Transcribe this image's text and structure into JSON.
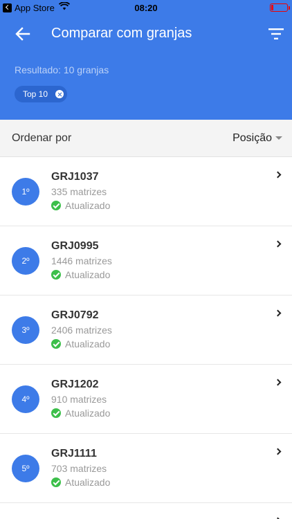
{
  "status_bar": {
    "carrier": "App Store",
    "time": "08:20"
  },
  "header": {
    "title": "Comparar com granjas",
    "result_text": "Resultado: 10 granjas",
    "chip_label": "Top 10",
    "accent_color": "#3d7be8"
  },
  "sort": {
    "label": "Ordenar por",
    "value": "Posição"
  },
  "farms": [
    {
      "rank": "1º",
      "code": "GRJ1037",
      "matrices": "335 matrizes",
      "status": "Atualizado"
    },
    {
      "rank": "2º",
      "code": "GRJ0995",
      "matrices": "1446 matrizes",
      "status": "Atualizado"
    },
    {
      "rank": "3º",
      "code": "GRJ0792",
      "matrices": "2406 matrizes",
      "status": "Atualizado"
    },
    {
      "rank": "4º",
      "code": "GRJ1202",
      "matrices": "910 matrizes",
      "status": "Atualizado"
    },
    {
      "rank": "5º",
      "code": "GRJ1111",
      "matrices": "703 matrizes",
      "status": "Atualizado"
    }
  ]
}
